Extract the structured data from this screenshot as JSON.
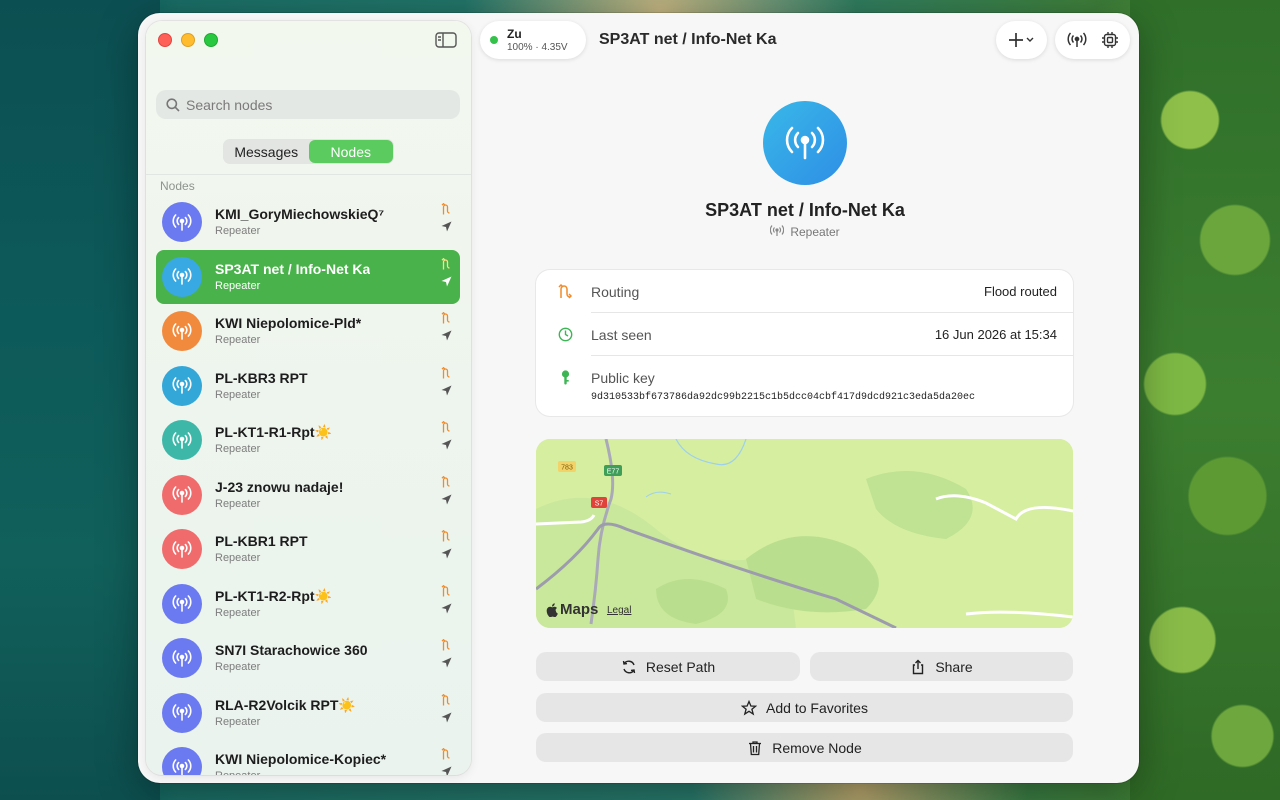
{
  "window": {
    "title": "SP3AT net / Info-Net Ka"
  },
  "device": {
    "name": "Zu",
    "battery": "100% · 4.35V",
    "status_color": "#35c24a"
  },
  "sidebar": {
    "search_placeholder": "Search nodes",
    "tabs": [
      {
        "label": "Messages",
        "active": false
      },
      {
        "label": "Nodes",
        "active": true
      }
    ],
    "section_label": "Nodes",
    "nodes": [
      {
        "name": "KMI_GoryMiechowskieQ⁷",
        "type": "Repeater",
        "color": "#6b7af0",
        "selected": false
      },
      {
        "name": "SP3AT net / Info-Net Ka",
        "type": "Repeater",
        "color": "#38a9e3",
        "selected": true
      },
      {
        "name": "KWI Niepolomice-Pld*",
        "type": "Repeater",
        "color": "#f28a3d",
        "selected": false
      },
      {
        "name": "PL-KBR3 RPT",
        "type": "Repeater",
        "color": "#33a7d8",
        "selected": false
      },
      {
        "name": "PL-KT1-R1-Rpt☀️",
        "type": "Repeater",
        "color": "#3db8a8",
        "selected": false
      },
      {
        "name": "J-23 znowu nadaje!",
        "type": "Repeater",
        "color": "#f06b6b",
        "selected": false
      },
      {
        "name": "PL-KBR1 RPT",
        "type": "Repeater",
        "color": "#f06b6b",
        "selected": false
      },
      {
        "name": "PL-KT1-R2-Rpt☀️",
        "type": "Repeater",
        "color": "#6b7af0",
        "selected": false
      },
      {
        "name": "SN7I Starachowice 360",
        "type": "Repeater",
        "color": "#6b7af0",
        "selected": false
      },
      {
        "name": "RLA-R2Volcik RPT☀️",
        "type": "Repeater",
        "color": "#6b7af0",
        "selected": false
      },
      {
        "name": "KWI Niepolomice-Kopiec*",
        "type": "Repeater",
        "color": "#6b7af0",
        "selected": false
      }
    ]
  },
  "detail": {
    "name": "SP3AT net / Info-Net Ka",
    "type": "Repeater",
    "routing_label": "Routing",
    "routing_value": "Flood routed",
    "last_seen_label": "Last seen",
    "last_seen_value": "16 Jun 2026 at 15:34",
    "public_key_label": "Public key",
    "public_key": "9d310533bf673786da92dc99b2215c1b5dcc04cbf417d9dcd921c3eda5da20ec"
  },
  "map": {
    "brand": "Maps",
    "legal": "Legal",
    "road_labels": [
      "783",
      "E77",
      "S7"
    ]
  },
  "actions": {
    "reset_path": "Reset Path",
    "share": "Share",
    "add_favorites": "Add to Favorites",
    "remove_node": "Remove Node"
  }
}
